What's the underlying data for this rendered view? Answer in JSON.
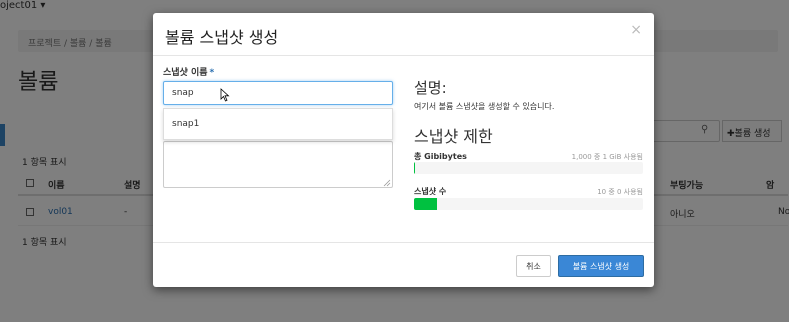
{
  "background": {
    "project_switcher": "oject01 ▾",
    "breadcrumb": "프로젝트 / 볼륨 / 볼륨",
    "page_title": "볼륨",
    "create_volume_button": "✚볼륨 생성",
    "item_count": "1 항목 표시",
    "table": {
      "headers": [
        "이름",
        "설명",
        "부팅가능",
        "암"
      ],
      "rows": [
        {
          "name": "vol01",
          "description": "-",
          "bootable": "아니오",
          "extra": "No"
        }
      ]
    },
    "item_count_bottom": "1 항목 표시"
  },
  "modal": {
    "title": "볼륨 스냅샷 생성",
    "close_glyph": "×",
    "name_label": "스냅샷 이름",
    "required_mark": "*",
    "name_value": "snap",
    "autocomplete_suggestion": "snap1",
    "description_heading": "설명:",
    "description_text": "여기서 볼륨 스냅샷을 생성할 수 있습니다.",
    "limit_heading": "스냅샷 제한",
    "quotas": [
      {
        "label": "총 Gibibytes",
        "usage": "1,000 중 1 GiB 사용됨",
        "fraction": 0.001
      },
      {
        "label": "스냅샷 수",
        "usage": "10 중 0 사용됨",
        "fraction": 0.1
      }
    ],
    "cancel_label": "취소",
    "submit_label": "볼륨 스냅샷 생성"
  },
  "colors": {
    "accent": "#3a87d6",
    "quota_fill": "#00c140",
    "focus_border": "#66afe9"
  }
}
